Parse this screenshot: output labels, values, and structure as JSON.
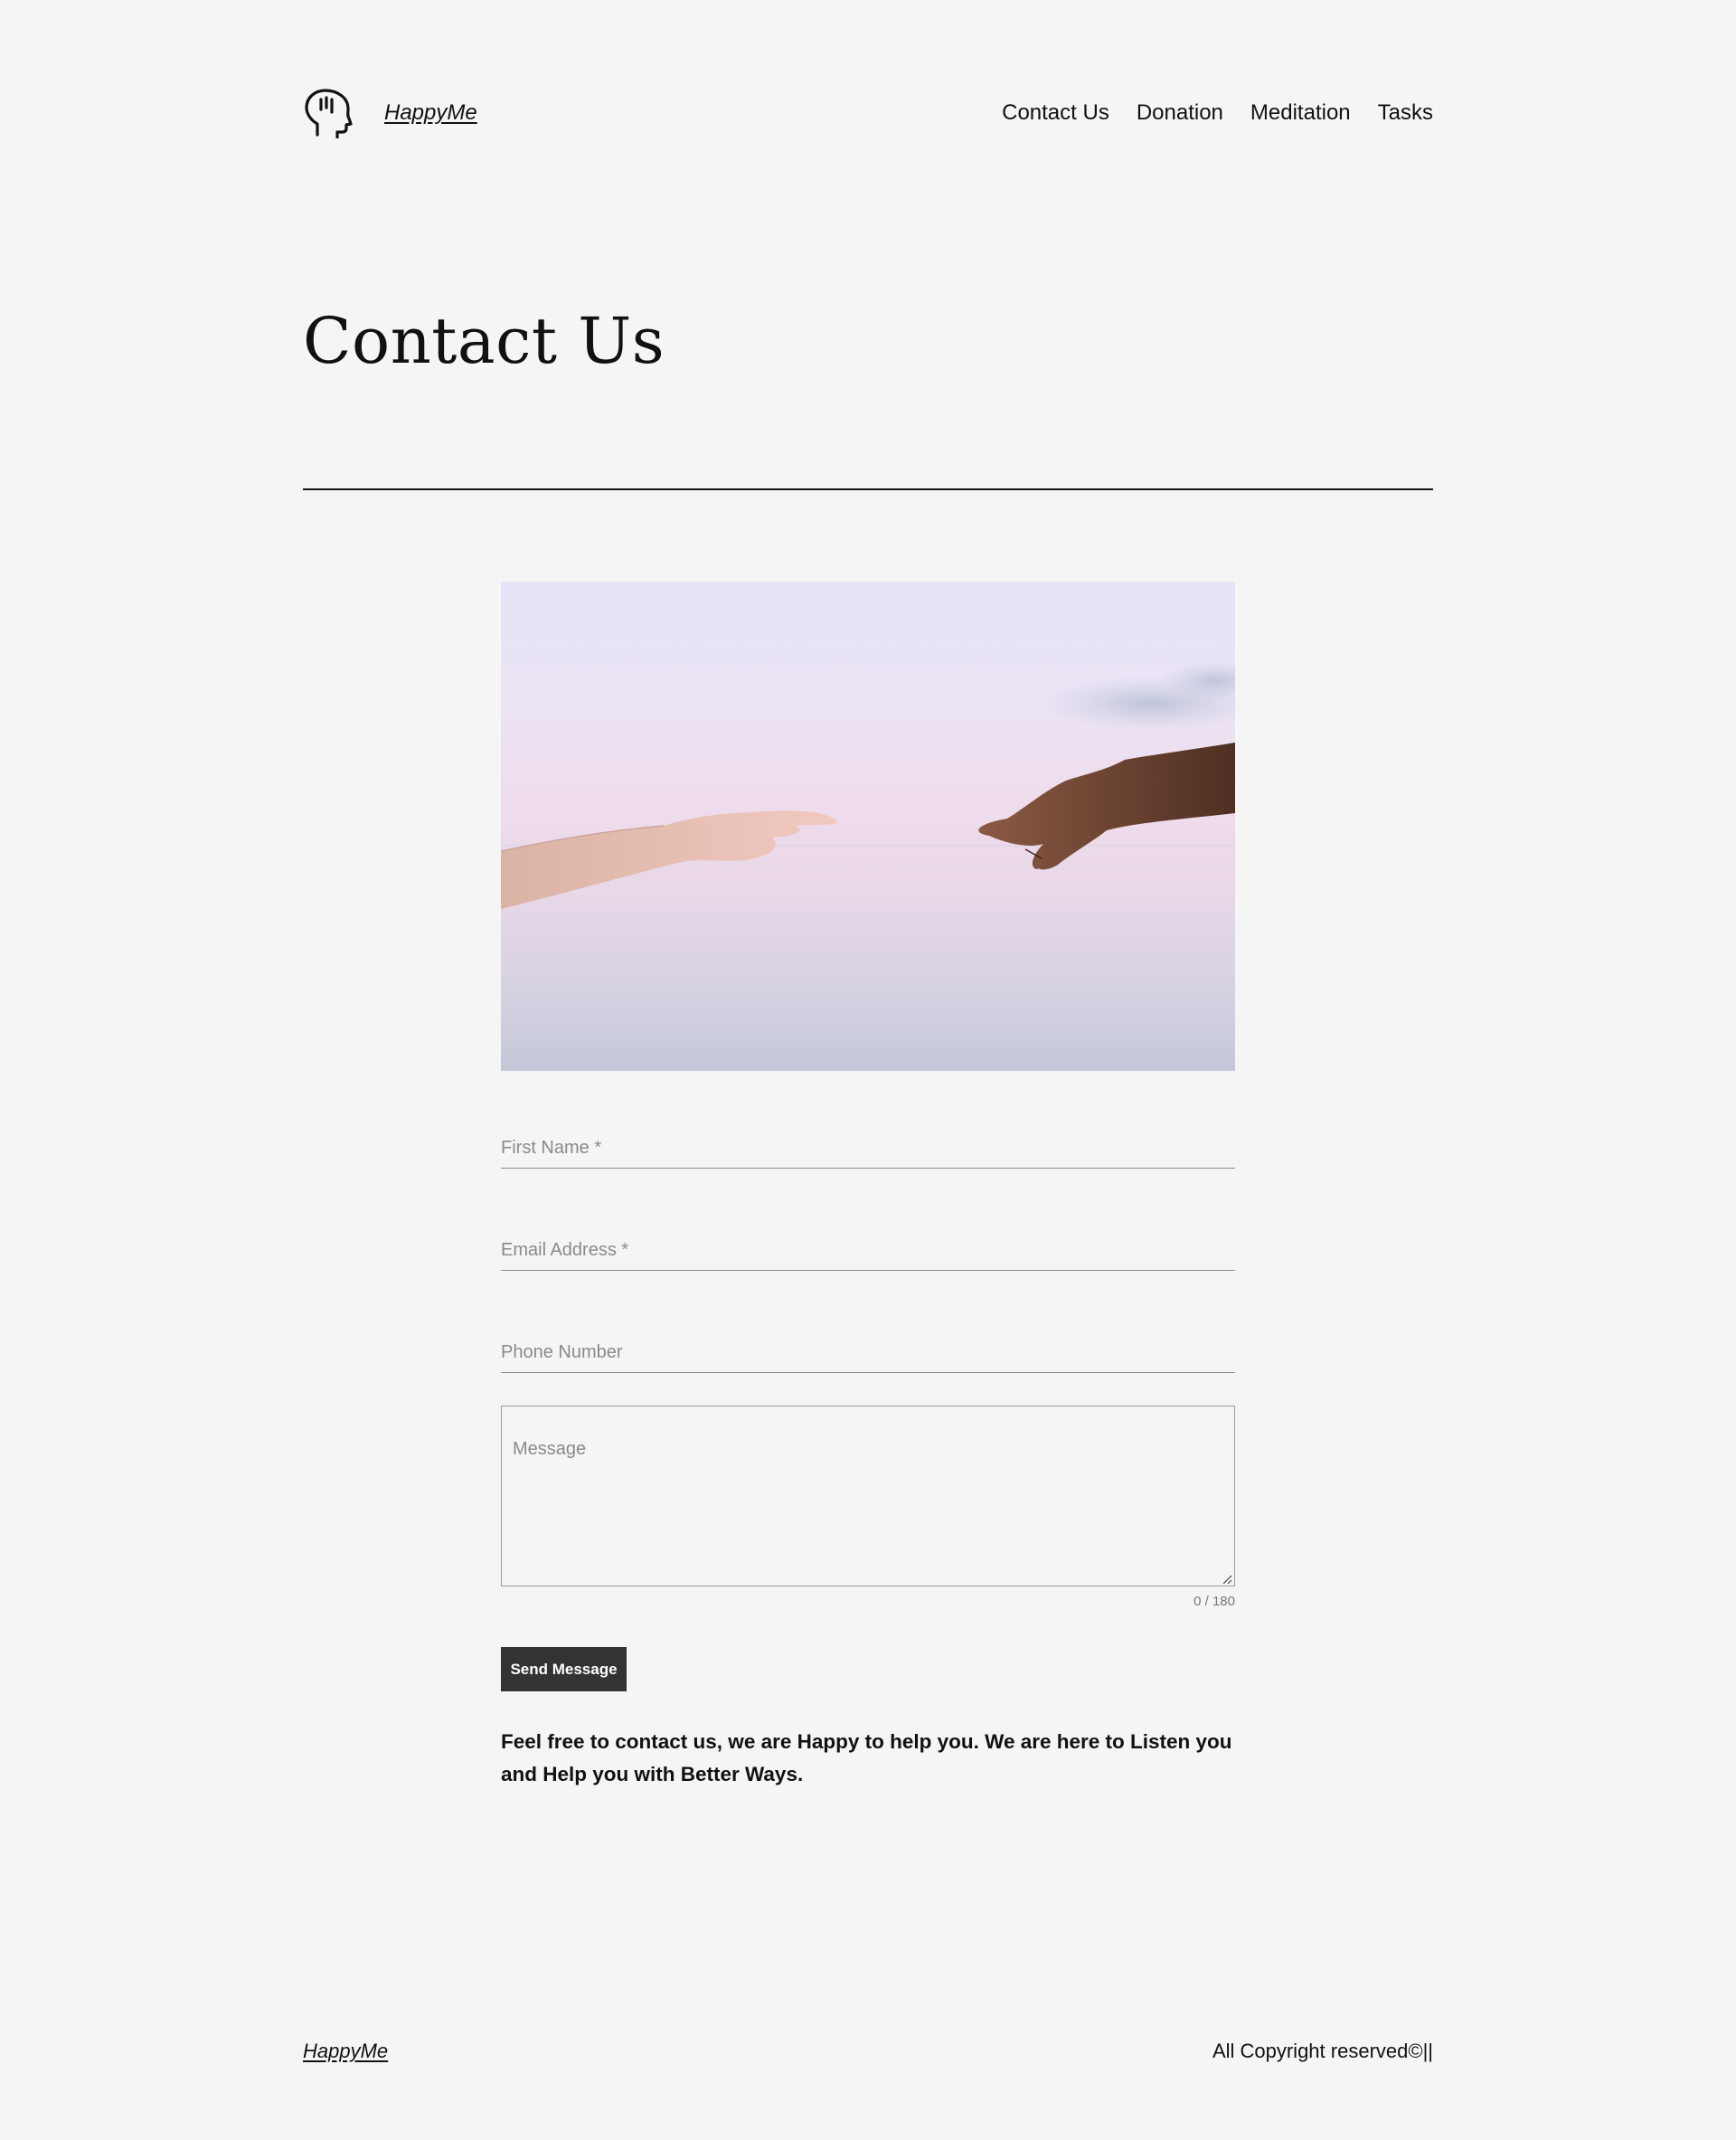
{
  "header": {
    "site_title": "HappyMe",
    "logo_icon": "head-speech-icon",
    "nav": [
      {
        "label": "Contact Us"
      },
      {
        "label": "Donation"
      },
      {
        "label": "Meditation"
      },
      {
        "label": "Tasks"
      }
    ]
  },
  "main": {
    "title": "Contact Us",
    "hero_image": "reaching-hands-photo",
    "form": {
      "first_name_placeholder": "First Name *",
      "email_placeholder": "Email Address *",
      "phone_placeholder": "Phone Number",
      "message_placeholder": "Message",
      "char_count": "0 / 180",
      "submit_label": "Send Message"
    },
    "note": "Feel free to contact us, we are Happy to help you. We are here to Listen you and Help you with Better Ways."
  },
  "footer": {
    "brand": "HappyMe",
    "copyright": "All Copyright reserved©||"
  },
  "colors": {
    "background": "#f5f5f5",
    "text": "#111111",
    "button": "#333333",
    "button_text": "#ffffff"
  }
}
